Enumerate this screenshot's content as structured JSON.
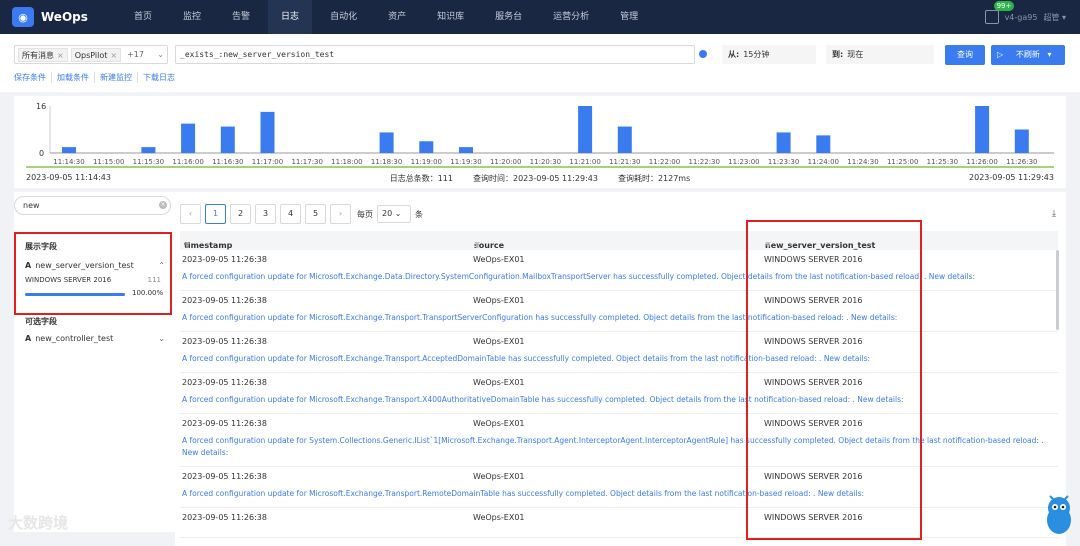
{
  "app": {
    "name": "WeOps"
  },
  "nav": [
    "首页",
    "监控",
    "告警",
    "日志",
    "自动化",
    "资产",
    "知识库",
    "服务台",
    "运营分析",
    "管理"
  ],
  "nav_active": "日志",
  "user": {
    "badge": "99+",
    "version": "v4-ga95",
    "name": "超管"
  },
  "filters": {
    "tags": [
      "所有消息",
      "OpsPilot"
    ],
    "more": "+17",
    "query": "_exists_:new_server_version_test",
    "from_label": "从:",
    "from_value": "15分钟",
    "to_label": "到:",
    "to_value": "现在",
    "search_btn": "查询",
    "refresh_btn": "不刷新"
  },
  "links": [
    "保存条件",
    "加载条件",
    "新建监控",
    "下载日志"
  ],
  "histogram": {
    "y_ticks": [
      "16",
      "0"
    ],
    "x_labels": [
      "11:14:30",
      "11:15:00",
      "11:15:30",
      "11:16:00",
      "11:16:30",
      "11:17:00",
      "11:17:30",
      "11:18:00",
      "11:18:30",
      "11:19:00",
      "11:19:30",
      "11:20:00",
      "11:20:30",
      "11:21:00",
      "11:21:30",
      "11:22:00",
      "11:22:30",
      "11:23:00",
      "11:23:30",
      "11:24:00",
      "11:24:30",
      "11:25:00",
      "11:25:30",
      "11:26:00",
      "11:26:30"
    ],
    "start": "2023-09-05 11:14:43",
    "end": "2023-09-05 11:29:43",
    "total": "日志总条数：111",
    "query_time": "查询时间：2023-09-05 11:29:43",
    "elapsed": "查询耗时：2127ms"
  },
  "chart_data": {
    "type": "bar",
    "categories": [
      "11:14:30",
      "11:15:00",
      "11:15:30",
      "11:16:00",
      "11:16:30",
      "11:17:00",
      "11:17:30",
      "11:18:00",
      "11:18:30",
      "11:19:00",
      "11:19:30",
      "11:20:00",
      "11:20:30",
      "11:21:00",
      "11:21:30",
      "11:22:00",
      "11:22:30",
      "11:23:00",
      "11:23:30",
      "11:24:00",
      "11:24:30",
      "11:25:00",
      "11:25:30",
      "11:26:00",
      "11:26:30"
    ],
    "values": [
      2,
      0,
      2,
      10,
      9,
      14,
      0,
      0,
      7,
      4,
      2,
      0,
      0,
      16,
      9,
      0,
      0,
      0,
      7,
      6,
      0,
      0,
      0,
      16,
      8
    ],
    "ylim": [
      0,
      16
    ]
  },
  "left": {
    "search_value": "new",
    "shown_title": "展示字段",
    "shown_field": "new_server_version_test",
    "shown_value": "WINDOWS SERVER 2016",
    "shown_count": "111",
    "shown_pct": "100.00%",
    "shown_fraction": 1.0,
    "optional_title": "可选字段",
    "optional_field": "new_controller_test"
  },
  "pager": {
    "pages": [
      "1",
      "2",
      "3",
      "4",
      "5"
    ],
    "per_page_label": "每页",
    "per_page": "20",
    "unit": "条"
  },
  "columns": [
    "timestamp",
    "source",
    "new_server_version_test"
  ],
  "rows": [
    {
      "ts": "2023-09-05 11:26:38",
      "src": "WeOps-EX01",
      "ver": "WINDOWS SERVER 2016",
      "msg": "A forced configuration update for Microsoft.Exchange.Data.Directory.SystemConfiguration.MailboxTransportServer has successfully completed. Object details from the last notification-based reload: . New details:"
    },
    {
      "ts": "2023-09-05 11:26:38",
      "src": "WeOps-EX01",
      "ver": "WINDOWS SERVER 2016",
      "msg": "A forced configuration update for Microsoft.Exchange.Transport.TransportServerConfiguration has successfully completed. Object details from the last notification-based reload: . New details:"
    },
    {
      "ts": "2023-09-05 11:26:38",
      "src": "WeOps-EX01",
      "ver": "WINDOWS SERVER 2016",
      "msg": "A forced configuration update for Microsoft.Exchange.Transport.AcceptedDomainTable has successfully completed. Object details from the last notification-based reload: . New details:"
    },
    {
      "ts": "2023-09-05 11:26:38",
      "src": "WeOps-EX01",
      "ver": "WINDOWS SERVER 2016",
      "msg": "A forced configuration update for Microsoft.Exchange.Transport.X400AuthoritativeDomainTable has successfully completed. Object details from the last notification-based reload: . New details:"
    },
    {
      "ts": "2023-09-05 11:26:38",
      "src": "WeOps-EX01",
      "ver": "WINDOWS SERVER 2016",
      "msg": "A forced configuration update for System.Collections.Generic.IList`1[Microsoft.Exchange.Transport.Agent.InterceptorAgent.InterceptorAgentRule] has successfully completed. Object details from the last notification-based reload: . New details:"
    },
    {
      "ts": "2023-09-05 11:26:38",
      "src": "WeOps-EX01",
      "ver": "WINDOWS SERVER 2016",
      "msg": "A forced configuration update for Microsoft.Exchange.Transport.RemoteDomainTable has successfully completed. Object details from the last notification-based reload: . New details:"
    },
    {
      "ts": "2023-09-05 11:26:38",
      "src": "WeOps-EX01",
      "ver": "WINDOWS SERVER 2016",
      "msg": ""
    }
  ],
  "watermark": "大数跨境",
  "colors": {
    "accent": "#3a7bf0",
    "topbar": "#1a2742",
    "highlight": "#e02020"
  }
}
